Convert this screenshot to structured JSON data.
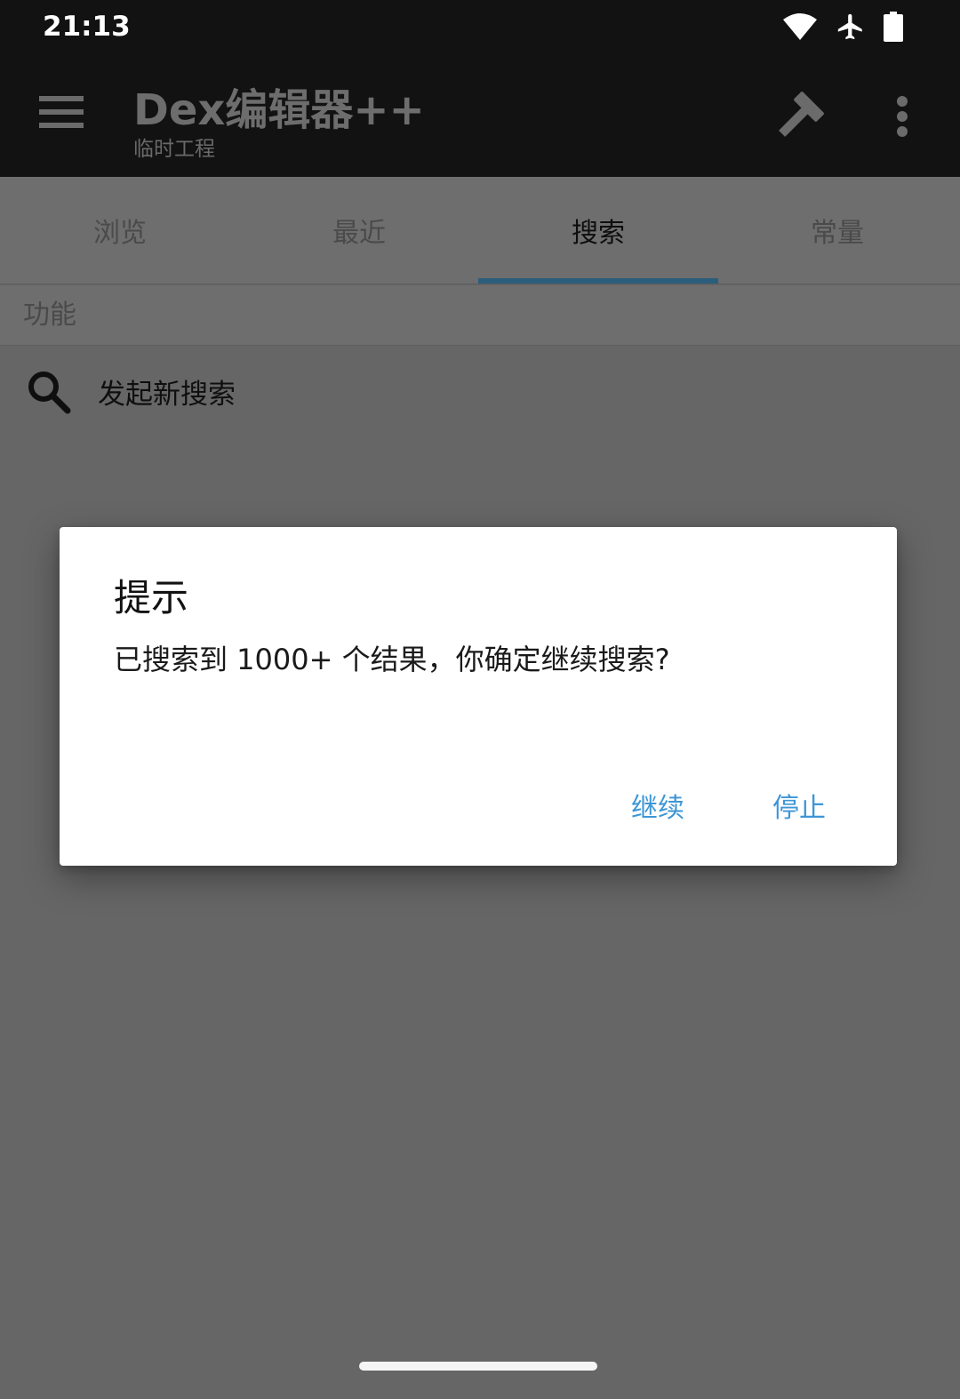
{
  "status_bar": {
    "time": "21:13",
    "icons": [
      "wifi-icon",
      "airplane-mode-icon",
      "battery-icon"
    ]
  },
  "app_bar": {
    "title": "Dex编辑器++",
    "subtitle": "临时工程",
    "icons": [
      "menu-icon",
      "hammer-icon",
      "more-vert-icon"
    ]
  },
  "tabs": [
    {
      "label": "浏览",
      "active": false
    },
    {
      "label": "最近",
      "active": false
    },
    {
      "label": "搜索",
      "active": true
    },
    {
      "label": "常量",
      "active": false
    }
  ],
  "section": {
    "header": "功能"
  },
  "search_item": {
    "label": "发起新搜索",
    "icon": "search-icon"
  },
  "dialog": {
    "title": "提示",
    "message": "已搜索到 1000+ 个结果，你确定继续搜索?",
    "continue_label": "继续",
    "stop_label": "停止"
  },
  "colors": {
    "accent": "#3d96d6",
    "tab_indicator": "#2b5d7c",
    "app_bar": "#121212",
    "scrim_background": "#666666"
  }
}
